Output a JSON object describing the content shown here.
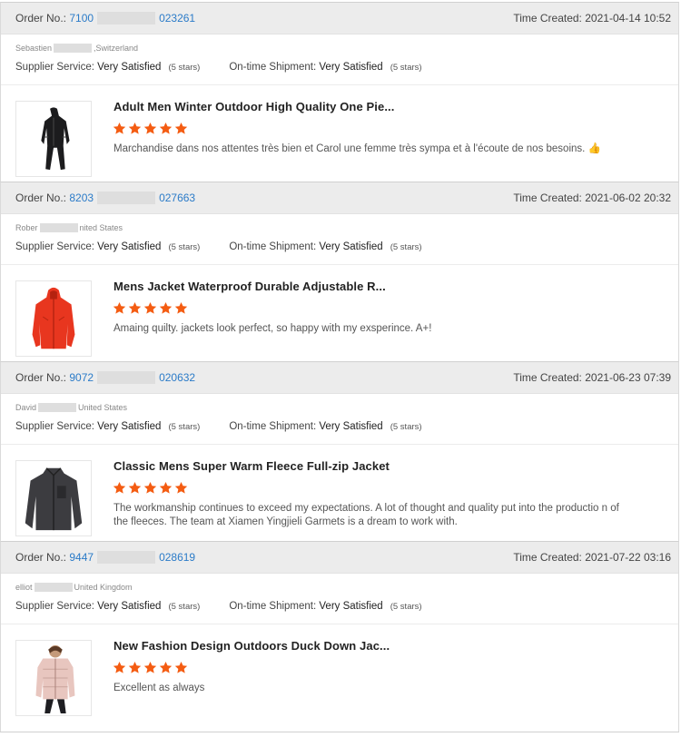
{
  "labels": {
    "order_no": "Order No.:",
    "time_created": "Time Created:",
    "supplier_service": "Supplier Service:",
    "ontime_shipment": "On-time Shipment:"
  },
  "colors": {
    "accent_link": "#2b7bc8",
    "star": "#f45c12",
    "header_bg": "#ececec"
  },
  "orders": [
    {
      "order_no_prefix": "7100",
      "order_no_suffix": "023261",
      "time": "2021-04-14 10:52",
      "buyer_name": "Sebastien",
      "buyer_country": ",Switzerland",
      "supplier_rating": "Very Satisfied",
      "supplier_stars": "(5 stars)",
      "shipment_rating": "Very Satisfied",
      "shipment_stars": "(5 stars)",
      "product_title": "Adult Men Winter Outdoor High Quality One Pie...",
      "rating": 5,
      "comment": "Marchandise dans nos attentes très bien et Carol une femme très sympa et à l'écoute de nos besoins. 👍",
      "image_icon": "black-ski-suit"
    },
    {
      "order_no_prefix": "8203",
      "order_no_suffix": "027663",
      "time": "2021-06-02 20:32",
      "buyer_name": "Rober",
      "buyer_country": "nited States",
      "supplier_rating": "Very Satisfied",
      "supplier_stars": "(5 stars)",
      "shipment_rating": "Very Satisfied",
      "shipment_stars": "(5 stars)",
      "product_title": "Mens Jacket Waterproof Durable Adjustable R...",
      "rating": 5,
      "comment": "Amaing quilty. jackets look perfect, so happy with my exsperince. A+!",
      "image_icon": "red-rain-jacket"
    },
    {
      "order_no_prefix": "9072",
      "order_no_suffix": "020632",
      "time": "2021-06-23 07:39",
      "buyer_name": "David",
      "buyer_country": "United States",
      "supplier_rating": "Very Satisfied",
      "supplier_stars": "(5 stars)",
      "shipment_rating": "Very Satisfied",
      "shipment_stars": "(5 stars)",
      "product_title": "Classic Mens Super Warm Fleece Full-zip Jacket",
      "rating": 5,
      "comment": "The workmanship continues to exceed my expectations. A lot of thought and quality put into the productio n of the fleeces. The team at Xiamen Yingjieli Garmets is a dream to work with.",
      "image_icon": "grey-fleece-jacket"
    },
    {
      "order_no_prefix": "9447",
      "order_no_suffix": "028619",
      "time": "2021-07-22 03:16",
      "buyer_name": "elliot",
      "buyer_country": "United Kingdom",
      "supplier_rating": "Very Satisfied",
      "supplier_stars": "(5 stars)",
      "shipment_rating": "Very Satisfied",
      "shipment_stars": "(5 stars)",
      "product_title": "New Fashion Design Outdoors Duck Down Jac...",
      "rating": 5,
      "comment": "Excellent as always",
      "image_icon": "pink-down-jacket"
    }
  ]
}
